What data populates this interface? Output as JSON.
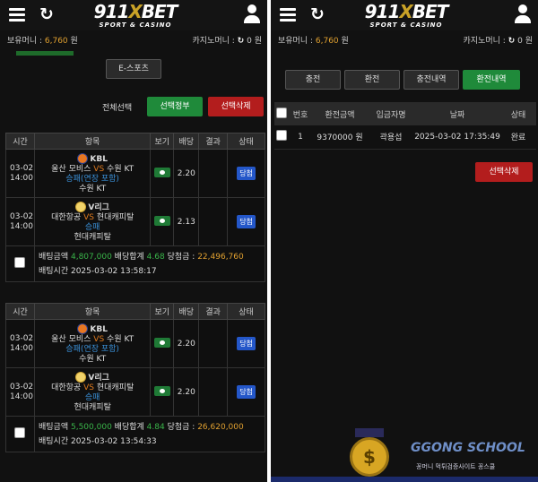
{
  "header": {
    "brand_num": "911",
    "brand_x": "X",
    "brand_bet": "BET",
    "brand_sub": "SPORT & CASINO"
  },
  "money": {
    "bonus_label": "보유머니 :",
    "bonus_value": "6,760",
    "bonus_unit": "원",
    "casino_label": "카지노머니 :",
    "casino_value": "0",
    "casino_unit": "원"
  },
  "left": {
    "esports_button": "E-스포츠",
    "select_all_label": "전체선택",
    "select_cancel_button": "선택정부",
    "select_delete_button": "선택삭제",
    "columns": [
      "시간",
      "항목",
      "보기",
      "배당",
      "결과",
      "상태"
    ],
    "slips": [
      {
        "matches": [
          {
            "date": "03-02",
            "time": "14:00",
            "league": "KBL",
            "home": "울산 모비스",
            "vs": "VS",
            "away": "수원 KT",
            "pick": "승패(연장 포함)",
            "pick_team": "수원 KT",
            "odds": "2.20",
            "status": "당첨"
          },
          {
            "date": "03-02",
            "time": "14:00",
            "league": "V리그",
            "home": "대한항공",
            "vs": "VS",
            "away": "현대캐피탈",
            "pick": "승패",
            "pick_team": "현대캐피탈",
            "odds": "2.13",
            "status": "당첨"
          }
        ],
        "amount_label": "배팅금액",
        "amount": "4,807,000",
        "total_odds_label": "배당합계",
        "total_odds": "4.68",
        "win_label": "당첨금 :",
        "win": "22,496,760",
        "time_label": "배팅시간",
        "time": "2025-03-02 13:58:17"
      },
      {
        "matches": [
          {
            "date": "03-02",
            "time": "14:00",
            "league": "KBL",
            "home": "울산 모비스",
            "vs": "VS",
            "away": "수원 KT",
            "pick": "승패(연장 포함)",
            "pick_team": "수원 KT",
            "odds": "2.20",
            "status": "당첨"
          },
          {
            "date": "03-02",
            "time": "14:00",
            "league": "V리그",
            "home": "대한항공",
            "vs": "VS",
            "away": "현대캐피탈",
            "pick": "승패",
            "pick_team": "현대캐피탈",
            "odds": "2.20",
            "status": "당첨"
          }
        ],
        "amount_label": "배팅금액",
        "amount": "5,500,000",
        "total_odds_label": "배당합계",
        "total_odds": "4.84",
        "win_label": "당첨금 :",
        "win": "26,620,000",
        "time_label": "배팅시간",
        "time": "2025-03-02 13:54:33"
      }
    ]
  },
  "right": {
    "tabs": [
      "충전",
      "환전",
      "충전내역",
      "환전내역"
    ],
    "active_tab": "환전내역",
    "columns": [
      "번호",
      "환전금액",
      "입금자명",
      "날짜",
      "상태"
    ],
    "rows": [
      {
        "no": "1",
        "amount": "9370000 원",
        "name": "곽용섭",
        "date": "2025-03-02 17:35:49",
        "status": "완료"
      }
    ],
    "delete_button": "선택삭제"
  },
  "watermark": {
    "coin_symbol": "$",
    "name": "GGONG SCHOOL",
    "tagline": "꽁머니 먹튀검증사이트 꽁스쿨"
  },
  "colors": {
    "accent_green": "#1f8a3a",
    "accent_red": "#b31d1d",
    "status_blue": "#2457c9",
    "gold": "#e0a030"
  }
}
